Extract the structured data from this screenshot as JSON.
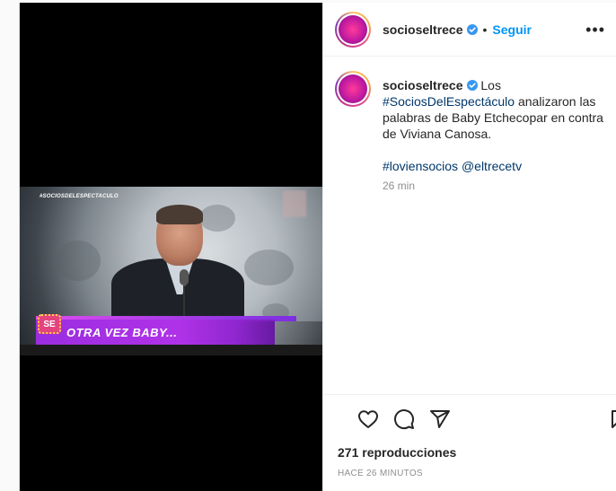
{
  "post": {
    "video": {
      "overlay_hashtag": "#SOCIOSDELESPECTACULO",
      "lower_third_text": "OTRA VEZ BABY...",
      "badge_text": "SE"
    },
    "header": {
      "username": "socioseltrece",
      "separator": "•",
      "follow_label": "Seguir",
      "more_label": "•••"
    },
    "caption": {
      "username": "socioseltrece",
      "text_before": " Los ",
      "hashtag_main": "#SociosDelEspectáculo",
      "text_after": " analizaron las palabras de Baby Etchecopar en contra de Viviana Canosa.",
      "tag_1": "#loviensocios",
      "tag_2": "@eltrecetv",
      "time": "26 min"
    },
    "stats": {
      "views": "271 reproducciones",
      "posted": "HACE 26 MINUTOS"
    },
    "icons": [
      "heart-icon",
      "comment-icon",
      "share-icon",
      "bookmark-icon",
      "verified-icon",
      "more-icon"
    ],
    "colors": {
      "accent": "#0095f6",
      "hashtag": "#00376b",
      "verified": "#3897f0",
      "lower_third": "#b032e8"
    }
  }
}
